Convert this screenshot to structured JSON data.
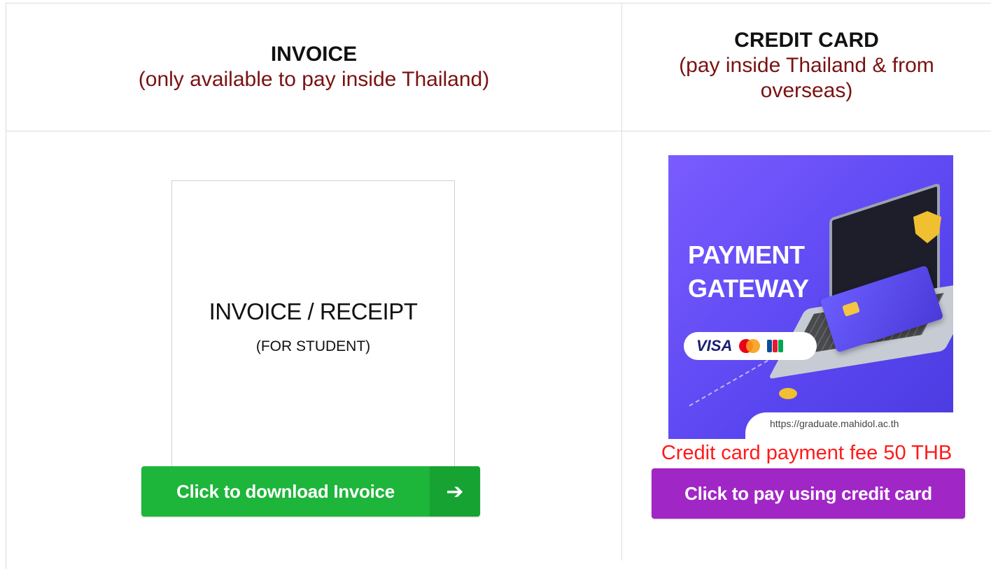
{
  "invoice_column": {
    "title": "INVOICE",
    "subtitle": "(only available to pay inside Thailand)",
    "thumbnail": {
      "title": "INVOICE / RECEIPT",
      "subtitle": "(FOR STUDENT)"
    },
    "button_label": "Click to download Invoice",
    "button_icon": "arrow-right-icon",
    "button_color": "#1db53a"
  },
  "credit_card_column": {
    "title": "CREDIT CARD",
    "subtitle": "(pay inside Thailand & from overseas)",
    "banner": {
      "line1": "PAYMENT",
      "line2": "GATEWAY",
      "brand_visa": "VISA",
      "url": "https://graduate.mahidol.ac.th"
    },
    "fee_text": "Credit card payment fee 50 THB",
    "fee_color": "#ff1a1a",
    "button_label": "Click to pay using credit card",
    "button_color": "#a126c6"
  }
}
